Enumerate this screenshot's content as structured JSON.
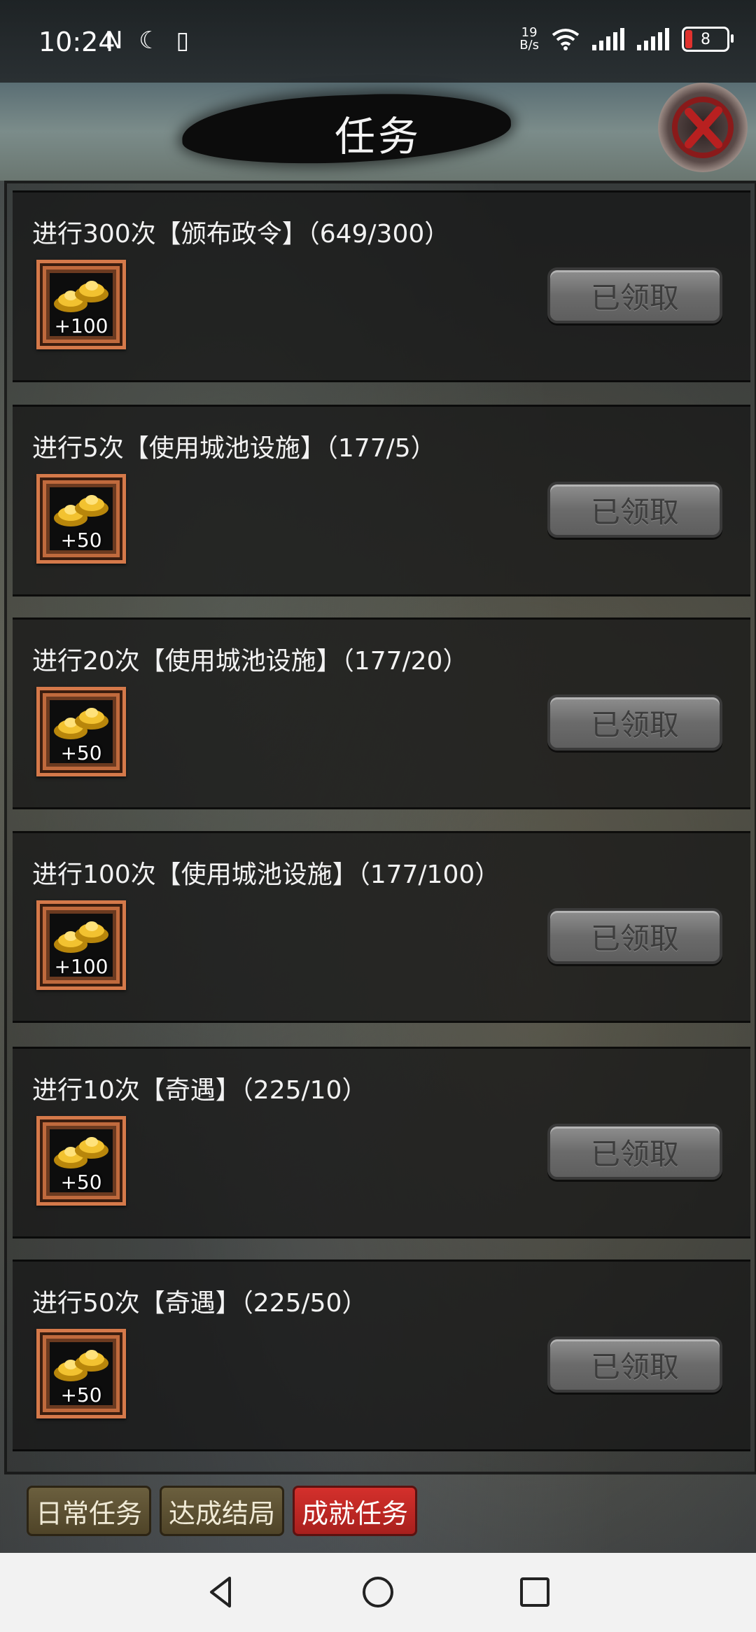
{
  "status_bar": {
    "time": "10:24",
    "left_icons": "N ☾ ▯",
    "net_speed_value": "19",
    "net_speed_unit": "B/s",
    "battery": "8"
  },
  "header": {
    "title": "任务"
  },
  "tasks": [
    {
      "title": "进行300次【颁布政令】（649/300）",
      "reward": "+100",
      "button": "已领取"
    },
    {
      "title": "进行5次【使用城池设施】（177/5）",
      "reward": "+50",
      "button": "已领取"
    },
    {
      "title": "进行20次【使用城池设施】（177/20）",
      "reward": "+50",
      "button": "已领取"
    },
    {
      "title": "进行100次【使用城池设施】（177/100）",
      "reward": "+100",
      "button": "已领取"
    },
    {
      "title": "进行10次【奇遇】（225/10）",
      "reward": "+50",
      "button": "已领取"
    },
    {
      "title": "进行50次【奇遇】（225/50）",
      "reward": "+50",
      "button": "已领取"
    }
  ],
  "tabs": [
    {
      "label": "日常任务",
      "active": false
    },
    {
      "label": "达成结局",
      "active": false
    },
    {
      "label": "成就任务",
      "active": true
    }
  ],
  "icons": {
    "reward": "gold-ingot-icon",
    "close": "close-icon"
  }
}
